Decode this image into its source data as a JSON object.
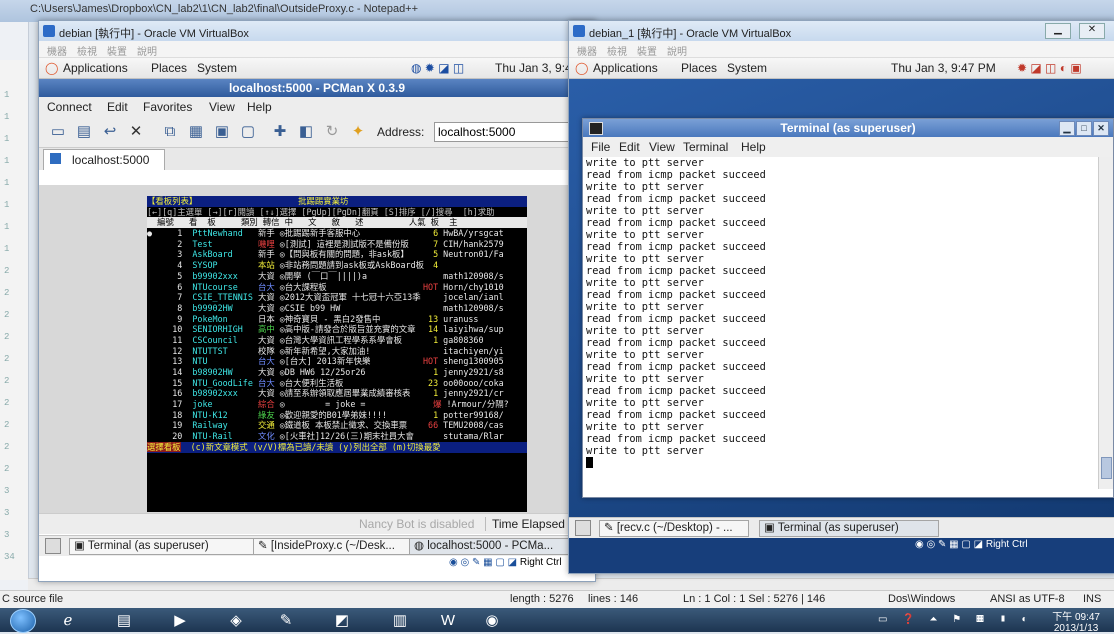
{
  "host": {
    "notepad_title": "C:\\Users\\James\\Dropbox\\CN_lab2\\1\\CN_lab2\\final\\OutsideProxy.c - Notepad++",
    "line_numbers": [
      "1",
      "1",
      "1",
      "1",
      "1",
      "1",
      "1",
      "1",
      "2",
      "2",
      "2",
      "2",
      "2",
      "2",
      "2",
      "2",
      "2",
      "2",
      "3",
      "3",
      "3",
      "34"
    ],
    "status": {
      "file_type": "C source file",
      "length": "length : 5276",
      "lines": "lines : 146",
      "position": "Ln : 1   Col : 1   Sel : 5276 | 146",
      "eol": "Dos\\Windows",
      "encoding": "ANSI as UTF-8",
      "mode": "INS"
    },
    "taskbar": {
      "clock_time": "下午 09:47",
      "clock_date": "2013/1/13"
    }
  },
  "vm_left": {
    "title": "debian [執行中] - Oracle VM VirtualBox",
    "vb_menu": [
      "機器",
      "檢視",
      "裝置",
      "說明"
    ],
    "gnome_panel": {
      "applications": "Applications",
      "places": "Places",
      "system": "System",
      "clock": "Thu Jan  3,  9:4"
    },
    "pcman": {
      "title": "localhost:5000 - PCMan X 0.3.9",
      "menu": [
        "Connect",
        "Edit",
        "Favorites",
        "View",
        "Help"
      ],
      "address_label": "Address:",
      "address_value": "localhost:5000",
      "tab": "localhost:5000",
      "status_disabled": "Nancy Bot is disabled",
      "status_elapsed": "Time Elapsed :"
    },
    "bbs": {
      "title_left": "【看板列表】",
      "title_center": "批踢踢實業坊",
      "help_line": "[←][q]主選單 [→][r]閱讀 [↑↓]選擇 [PgUp][PgDn]翻頁 [S]排序 [/]搜尋  [h]求助",
      "col_header": "  編號   看  板     類別 轉信 中   文   敘   述         人氣 板  主",
      "rows": [
        {
          "num": "1",
          "board": "PttNewhand",
          "cat": "新手",
          "desc": "◎批踢踢新手客服中心",
          "pop": "6",
          "bm": "HwBA/yrsgcat"
        },
        {
          "num": "2",
          "board": "Test",
          "cat": "嘰哩",
          "desc": "◎[測試] 這裡是測試版不是備份版",
          "pop": "7",
          "bm": "CIH/hank2579"
        },
        {
          "num": "3",
          "board": "AskBoard",
          "cat": "新手",
          "desc": "◎【問與板有關的問題，非ask板】",
          "pop": "5",
          "bm": "Neutron01/Fa"
        },
        {
          "num": "4",
          "board": "SYSOP",
          "cat": "本站",
          "desc": "◎非站務問題請到ask板或AskBoard板",
          "pop": "4",
          "bm": ""
        },
        {
          "num": "5",
          "board": "b99902xxx",
          "cat": "大資",
          "desc": "◎開學 (￣口￣||||)a",
          "pop": "",
          "bm": "math120908/s"
        },
        {
          "num": "6",
          "board": "NTUcourse",
          "cat": "台大",
          "desc": "◎台大課程板",
          "pop": "HOT",
          "bm": "Horn/chy1010"
        },
        {
          "num": "7",
          "board": "CSIE_TTENNIS",
          "cat": "大資",
          "desc": "◎2012大資盃冠軍 十七冠十六亞13季",
          "pop": "",
          "bm": "jocelan/ianl"
        },
        {
          "num": "8",
          "board": "b99902HW",
          "cat": "大資",
          "desc": "◎CSIE b99 HW",
          "pop": "",
          "bm": "math120908/s"
        },
        {
          "num": "9",
          "board": "PokeMon",
          "cat": "日本",
          "desc": "◎神奇寶貝 - 黑白2發售中",
          "pop": "13",
          "bm": "uranuss"
        },
        {
          "num": "10",
          "board": "SENIORHIGH",
          "cat": "高中",
          "desc": "◎高中版-請發合於版旨並充實的文章",
          "pop": "14",
          "bm": "laiyihwa/sup"
        },
        {
          "num": "11",
          "board": "CSCouncil",
          "cat": "大資",
          "desc": "◎台灣大學資訊工程學系系學會板",
          "pop": "1",
          "bm": "ga808360"
        },
        {
          "num": "12",
          "board": "NTUTTST",
          "cat": "校隊",
          "desc": "◎新年新希望,大家加油!",
          "pop": "",
          "bm": "itachiyen/yi"
        },
        {
          "num": "13",
          "board": "NTU",
          "cat": "台大",
          "desc": "◎[台大] 2013新年快樂",
          "pop": "HOT",
          "bm": "sheng1300905"
        },
        {
          "num": "14",
          "board": "b98902HW",
          "cat": "大資",
          "desc": "◎DB HW6 12/25or26",
          "pop": "1",
          "bm": "jenny2921/s8"
        },
        {
          "num": "15",
          "board": "NTU_GoodLife",
          "cat": "台大",
          "desc": "◎台大便利生活板",
          "pop": "23",
          "bm": "oo00ooo/coka"
        },
        {
          "num": "16",
          "board": "b98902xxx",
          "cat": "大資",
          "desc": "◎請至系辦領取應屆畢業成績審核表",
          "pop": "1",
          "bm": "jenny2921/cr"
        },
        {
          "num": "17",
          "board": "joke",
          "cat": "綜合",
          "desc": "◎        = joke =",
          "pop": "爆",
          "bm": "!Armour/分隔?"
        },
        {
          "num": "18",
          "board": "NTU-K12",
          "cat": "綠友",
          "desc": "◎歡迎親愛的B01學弟妹!!!!",
          "pop": "1",
          "bm": "potter99168/"
        },
        {
          "num": "19",
          "board": "Railway",
          "cat": "交通",
          "desc": "◎鐵道板 本板禁止徵求、交換車票",
          "pop": "66",
          "bm": "TEMU2008/cas"
        },
        {
          "num": "20",
          "board": "NTU-Rail",
          "cat": "文化",
          "desc": "◎[火車社]12/26(三)期末社員大會",
          "pop": "",
          "bm": "stutama/Rlar"
        }
      ],
      "footer_left": "選擇看板",
      "footer_right": "(c)新文章模式 (v/V)標為已讀/未讀 (y)列出全部 (m)切換最愛"
    },
    "gnome_tasks": [
      "Terminal (as superuser)",
      "[InsideProxy.c (~/Desk...",
      "localhost:5000 - PCMa..."
    ]
  },
  "vm_right": {
    "title": "debian_1 [執行中] - Oracle VM VirtualBox",
    "vb_menu": [
      "機器",
      "檢視",
      "裝置",
      "說明"
    ],
    "gnome_panel": {
      "applications": "Applications",
      "places": "Places",
      "system": "System",
      "clock": "Thu Jan  3,  9:47 PM"
    },
    "terminal": {
      "title": "Terminal (as superuser)",
      "menu": [
        "File",
        "Edit",
        "View",
        "Terminal",
        "Help"
      ],
      "lines": [
        "write to ptt server",
        "read from icmp packet succeed",
        "write to ptt server",
        "read from icmp packet succeed",
        "write to ptt server",
        "read from icmp packet succeed",
        "write to ptt server",
        "read from icmp packet succeed",
        "write to ptt server",
        "read from icmp packet succeed",
        "write to ptt server",
        "read from icmp packet succeed",
        "write to ptt server",
        "read from icmp packet succeed",
        "write to ptt server",
        "read from icmp packet succeed",
        "write to ptt server",
        "read from icmp packet succeed",
        "write to ptt server",
        "read from icmp packet succeed",
        "write to ptt server",
        "read from icmp packet succeed",
        "write to ptt server",
        "read from icmp packet succeed",
        "write to ptt server"
      ]
    },
    "gnome_tasks": [
      "[recv.c (~/Desktop) - ...",
      "Terminal (as superuser)"
    ],
    "right_ctrl": "Right Ctrl"
  },
  "left_right_ctrl": "Right Ctrl"
}
